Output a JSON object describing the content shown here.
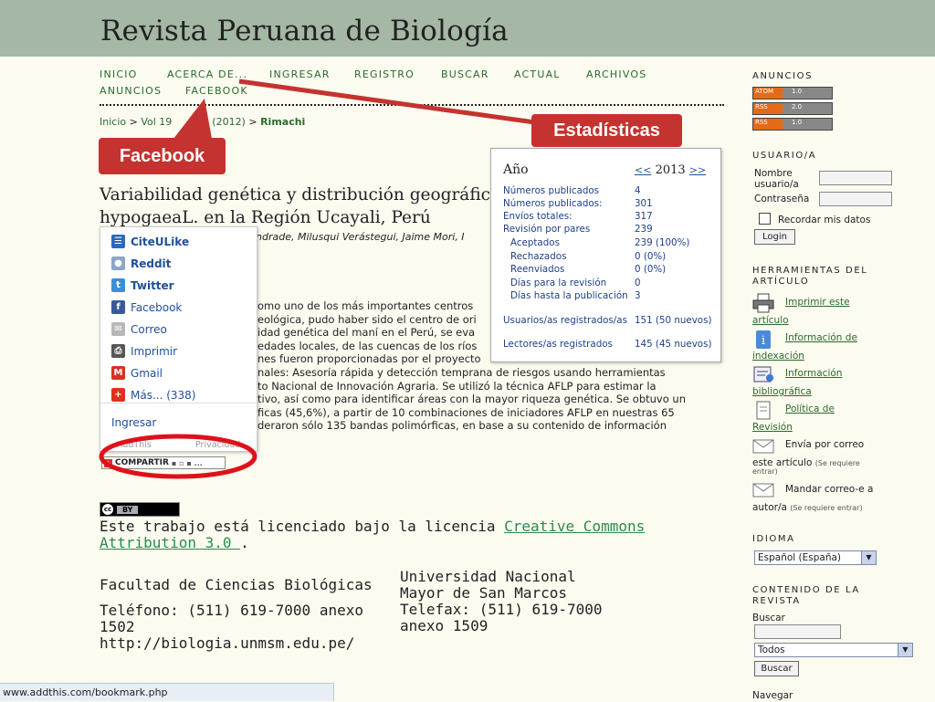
{
  "site": {
    "title": "Revista Peruana de Biología"
  },
  "nav": {
    "items": [
      "INICIO",
      "ACERCA DE...",
      "INGRESAR",
      "REGISTRO",
      "BUSCAR",
      "ACTUAL",
      "ARCHIVOS",
      "ANUNCIOS",
      "FACEBOOK"
    ]
  },
  "breadcrumb": {
    "home": "Inicio",
    "sep": ">",
    "vol": "Vol 19",
    "num": "3 (2012)",
    "current": "Rimachi"
  },
  "article": {
    "title_line1": "Variabilidad genética y distribución geográfic",
    "title_line2": "hypogaeaL. en la Región Ucayali, Perú",
    "authors": "ndrade, Milusqui Verástegui, Jaime Mori, I",
    "abstract_lines": [
      "omo uno de los más importantes centros",
      "eológica, pudo haber sido el centro de ori",
      "idad genética del maní en el Perú, se eva",
      "edades locales, de las cuencas de los ríos",
      "nes fueron proporcionadas por el proyecto",
      "nales: Asesoría rápida y detección temprana de riesgos usando herramientas",
      "to Nacional de Innovación Agraria. Se utilizó la técnica AFLP para estimar la",
      "tivo, así como para identificar áreas con la mayor riqueza genética. Se obtuvo un",
      "ficas (45,6%), a partir de 10 combinaciones de iniciadores AFLP en nuestras 65",
      "deraron sólo 135 bandas polimórficas, en base a su contenido de información"
    ]
  },
  "share_menu": {
    "items": [
      {
        "label": "CiteULike",
        "icon": "citeulike-icon",
        "color": "#2a6ab8"
      },
      {
        "label": "Reddit",
        "icon": "reddit-icon",
        "color": "#8aa6c8"
      },
      {
        "label": "Twitter",
        "icon": "twitter-icon",
        "color": "#3b8fd8"
      },
      {
        "label": "Facebook",
        "icon": "facebook-icon",
        "color": "#3b5998"
      },
      {
        "label": "Correo",
        "icon": "mail-icon",
        "color": "#b8b8b8"
      },
      {
        "label": "Imprimir",
        "icon": "printer-icon",
        "color": "#555555"
      },
      {
        "label": "Gmail",
        "icon": "gmail-icon",
        "color": "#d93025"
      },
      {
        "label": "Más... (338)",
        "icon": "plus-icon",
        "color": "#e3301e"
      }
    ],
    "login": "Ingresar",
    "brand": "AddThis",
    "privacy": "Privacidad",
    "compartir": "COMPARTIR"
  },
  "license": {
    "badge_cc": "cc",
    "badge_by": "BY",
    "prefix": "Este trabajo está licenciado bajo la licencia ",
    "link": "Creative Commons Attribution 3.0 ",
    "suffix": "."
  },
  "footer": {
    "col1": [
      "Facultad de Ciencias Biológicas",
      "",
      "Teléfono: (511) 619-7000 anexo",
      "1502",
      "http://biologia.unmsm.edu.pe/"
    ],
    "col2": [
      "Universidad Nacional",
      "Mayor de San Marcos",
      "Telefax: (511) 619-7000",
      "anexo 1509"
    ]
  },
  "stats": {
    "year_label": "Año",
    "prev": "<<",
    "year": "2013",
    "next": ">>",
    "rows": [
      {
        "label": "Números publicados",
        "value": "4",
        "indent": false
      },
      {
        "label": "Números publicados:",
        "value": "301",
        "indent": false
      },
      {
        "label": "Envíos totales:",
        "value": "317",
        "indent": false
      },
      {
        "label": "Revisión por pares",
        "value": "239",
        "indent": false
      },
      {
        "label": "Aceptados",
        "value": "239 (100%)",
        "indent": true
      },
      {
        "label": "Rechazados",
        "value": "0 (0%)",
        "indent": true
      },
      {
        "label": "Reenviados",
        "value": "0 (0%)",
        "indent": true
      },
      {
        "label": "Días para la revisión",
        "value": "0",
        "indent": true
      },
      {
        "label": "Días hasta la publicación",
        "value": "3",
        "indent": true
      },
      {
        "label": "Usuarios/as registrados/as",
        "value": "151 (50 nuevos)",
        "indent": false
      },
      {
        "label": "Lectores/as registrados",
        "value": "145 (45 nuevos)",
        "indent": false
      }
    ]
  },
  "callouts": {
    "facebook": "Facebook",
    "estadisticas": "Estadísticas",
    "color": "#c4332f"
  },
  "sidebar": {
    "anuncios_head": "ANUNCIOS",
    "feeds": [
      {
        "left": "ATOM",
        "right": "1.0"
      },
      {
        "left": "RSS",
        "right": "2.0"
      },
      {
        "left": "RSS",
        "right": "1.0"
      }
    ],
    "user_head": "USUARIO/A",
    "username_label_1": "Nombre",
    "username_label_2": "usuario/a",
    "password_label": "Contraseña",
    "remember": "Recordar mis datos",
    "login_btn": "Login",
    "tools_head_1": "HERRAMIENTAS DEL",
    "tools_head_2": "ARTÍCULO",
    "print_1": "Imprimir este",
    "print_2": "artículo",
    "index_1": "Información de",
    "index_2": "indexación",
    "biblio_1": "Información",
    "biblio_2": "bibliográfica",
    "policy_1": "Política de",
    "policy_2": "Revisión",
    "email_article_1": "Envía por correo",
    "email_article_2": "este artículo",
    "email_article_note_1": "(Se requiere",
    "email_article_note_2": "entrar)",
    "email_author_1": "Mandar correo-e a",
    "email_author_2": "autor/a",
    "email_author_note": "(Se requiere entrar)",
    "lang_head": "IDIOMA",
    "lang_value": "Español (España)",
    "content_head_1": "CONTENIDO DE LA",
    "content_head_2": "REVISTA",
    "search_label": "Buscar",
    "scope_value": "Todos",
    "search_btn": "Buscar",
    "browse_label": "Navegar"
  },
  "status_bar": {
    "url": "www.addthis.com/bookmark.php"
  }
}
